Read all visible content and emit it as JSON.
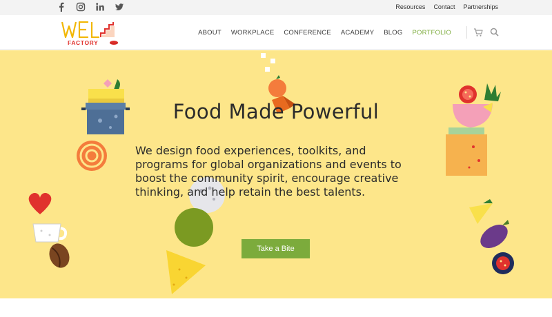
{
  "topbar": {
    "social": [
      "facebook",
      "instagram",
      "linkedin",
      "twitter"
    ],
    "links": [
      "Resources",
      "Contact",
      "Partnerships"
    ]
  },
  "logo": {
    "text_main": "WE",
    "text_sub": "FACTORY"
  },
  "nav": {
    "items": [
      "ABOUT",
      "WORKPLACE",
      "CONFERENCE",
      "ACADEMY",
      "BLOG",
      "PORTFOLIO"
    ],
    "active": "PORTFOLIO",
    "icons": [
      "cart-icon",
      "search-icon"
    ]
  },
  "hero": {
    "title": "Food Made Powerful",
    "description": "We design food experiences, toolkits, and programs for global organizations and events to boost the community spirit, encourage creative thinking, and help retain the best talents.",
    "cta_label": "Take a Bite"
  },
  "colors": {
    "hero_bg": "#fde68a",
    "accent_green": "#7cab3c",
    "logo_yellow": "#f2b705",
    "logo_red": "#e0322d"
  }
}
